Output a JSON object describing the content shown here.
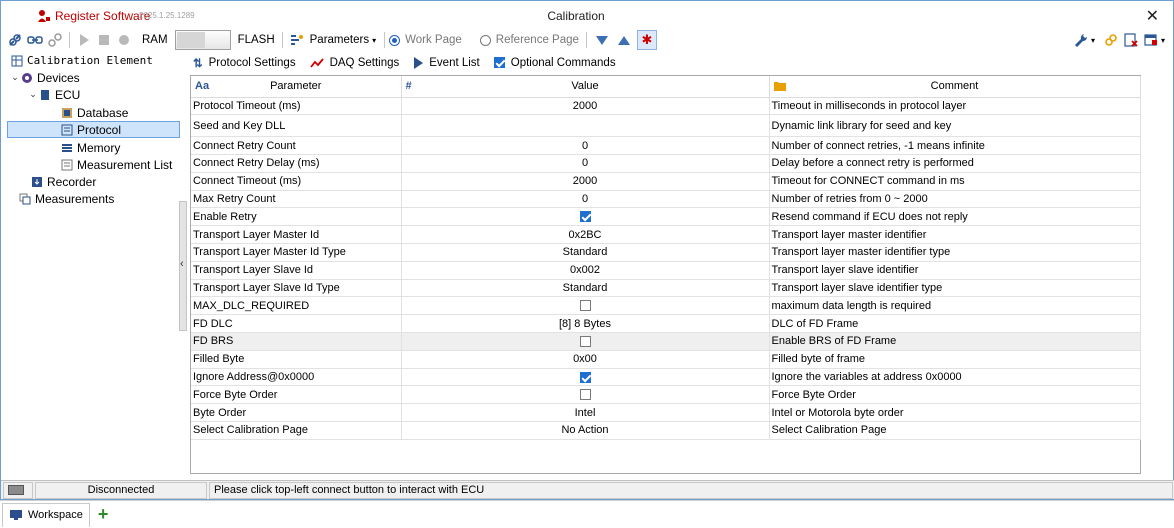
{
  "window": {
    "app_name": "Register Software",
    "app_version": "2025.1.25.1289",
    "title": "Calibration",
    "close_label": "✕"
  },
  "toolbar": {
    "ram_label": "RAM",
    "flash_label": "FLASH",
    "parameters_label": "Parameters",
    "work_page_label": "Work Page",
    "reference_page_label": "Reference Page",
    "selected_page": "Work Page"
  },
  "tree": {
    "root_label": "Calibration Element",
    "items": [
      {
        "label": "Devices"
      },
      {
        "label": "ECU"
      },
      {
        "label": "Database"
      },
      {
        "label": "Protocol"
      },
      {
        "label": "Memory"
      },
      {
        "label": "Measurement List"
      },
      {
        "label": "Recorder"
      },
      {
        "label": "Measurements"
      }
    ],
    "selected": "Protocol"
  },
  "tabs": [
    {
      "label": "Protocol Settings"
    },
    {
      "label": "DAQ Settings"
    },
    {
      "label": "Event List"
    },
    {
      "label": "Optional Commands"
    }
  ],
  "table": {
    "headers": {
      "parameter": "Parameter",
      "value": "Value",
      "comment": "Comment"
    },
    "header_icons": {
      "parameter": "Aa",
      "value": "#"
    },
    "rows": [
      {
        "parameter": "Protocol Timeout (ms)",
        "value": "2000",
        "comment": "Timeout in milliseconds in protocol layer"
      },
      {
        "parameter": "Seed and Key DLL",
        "value": "",
        "comment": "Dynamic link library for seed and key"
      },
      {
        "parameter": "Connect Retry Count",
        "value": "0",
        "comment": "Number of connect retries, -1 means infinite"
      },
      {
        "parameter": "Connect Retry Delay (ms)",
        "value": "0",
        "comment": "Delay before a connect retry is performed"
      },
      {
        "parameter": "Connect Timeout (ms)",
        "value": "2000",
        "comment": "Timeout for CONNECT command in ms"
      },
      {
        "parameter": "Max Retry Count",
        "value": "0",
        "comment": "Number of retries from 0 ~ 2000"
      },
      {
        "parameter": "Enable Retry",
        "value": "",
        "checkbox": true,
        "comment": "Resend command if ECU does not reply"
      },
      {
        "parameter": "Transport Layer Master Id",
        "value": "0x2BC",
        "comment": "Transport layer master identifier"
      },
      {
        "parameter": "Transport Layer Master Id Type",
        "value": "Standard",
        "comment": "Transport layer master identifier type"
      },
      {
        "parameter": "Transport Layer Slave Id",
        "value": "0x002",
        "comment": "Transport layer slave identifier"
      },
      {
        "parameter": "Transport Layer Slave Id Type",
        "value": "Standard",
        "comment": "Transport layer slave identifier type"
      },
      {
        "parameter": "MAX_DLC_REQUIRED",
        "value": "",
        "checkbox": false,
        "comment": "maximum data length is required"
      },
      {
        "parameter": "FD DLC",
        "value": "[8]   8 Bytes",
        "comment": "DLC of FD Frame"
      },
      {
        "parameter": "FD BRS",
        "value": "",
        "checkbox": false,
        "comment": "Enable BRS of FD Frame"
      },
      {
        "parameter": "Filled Byte",
        "value": "0x00",
        "comment": "Filled byte of frame"
      },
      {
        "parameter": "Ignore Address@0x0000",
        "value": "",
        "checkbox": true,
        "comment": "Ignore the variables at address 0x0000"
      },
      {
        "parameter": "Force Byte Order",
        "value": "",
        "checkbox": false,
        "comment": "Force Byte Order"
      },
      {
        "parameter": "Byte Order",
        "value": "Intel",
        "comment": "Intel or Motorola byte order"
      },
      {
        "parameter": "Select Calibration Page",
        "value": "No Action",
        "comment": "Select Calibration Page"
      }
    ]
  },
  "status": {
    "connection": "Disconnected",
    "message": "Please click top-left connect button to interact with ECU"
  },
  "taskbar": {
    "workspace_label": "Workspace",
    "add_label": "+"
  },
  "colors": {
    "accent": "#1f5fbf",
    "brand": "#c00000",
    "selection": "#cde4fb"
  }
}
